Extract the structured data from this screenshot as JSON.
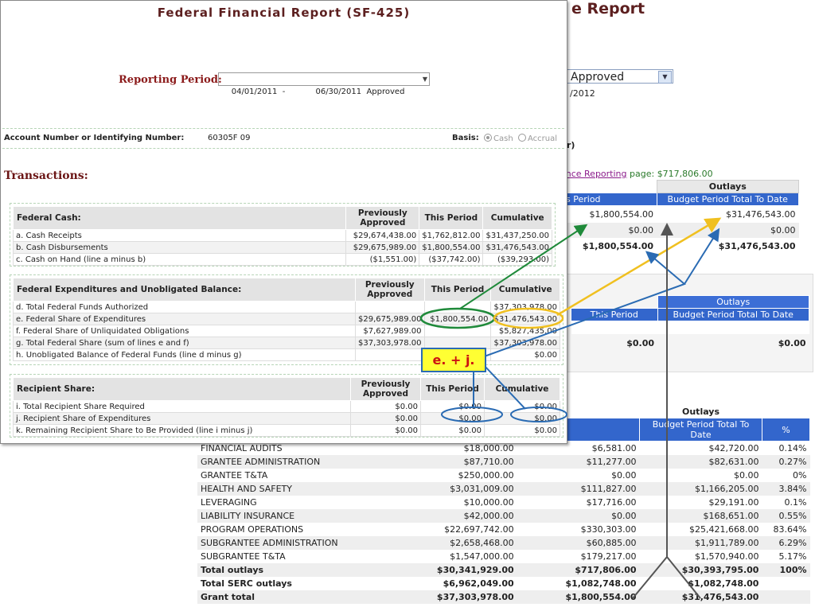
{
  "background": {
    "title": "e Report",
    "status_select": "Approved",
    "year_text": "/2012",
    "paren_text": "r)",
    "link_prefix": "ance Reporting",
    "link_suffix": " page: ",
    "link_amount": "$717,806.00",
    "panel1": {
      "outlays_label": "Outlays",
      "col_this_period": "s Period",
      "col_budget_total": "Budget Period Total To Date",
      "rows": [
        {
          "this_period": "$1,800,554.00",
          "budget_total": "$31,476,543.00",
          "bold": false
        },
        {
          "this_period": "$0.00",
          "budget_total": "$0.00",
          "bold": false
        },
        {
          "this_period": "$1,800,554.00",
          "budget_total": "$31,476,543.00",
          "bold": true
        }
      ]
    },
    "panel2": {
      "outlays_label": "Outlays",
      "col_this_period": "This Period",
      "col_budget_total": "Budget Period Total To Date",
      "total_this_period": "$0.00",
      "total_budget": "$0.00"
    },
    "panel3": {
      "outlays_label": "Outlays",
      "col_this_period": "s Period",
      "col_budget_total": "Budget Period Total To Date",
      "col_pct": "%",
      "rows": [
        {
          "name": "FINANCIAL AUDITS",
          "budget": "$18,000.00",
          "this_period": "$6,581.00",
          "total": "$42,720.00",
          "pct": "0.14%",
          "bold": false
        },
        {
          "name": "GRANTEE ADMINISTRATION",
          "budget": "$87,710.00",
          "this_period": "$11,277.00",
          "total": "$82,631.00",
          "pct": "0.27%",
          "bold": false
        },
        {
          "name": "GRANTEE T&TA",
          "budget": "$250,000.00",
          "this_period": "$0.00",
          "total": "$0.00",
          "pct": "0%",
          "bold": false
        },
        {
          "name": "HEALTH AND SAFETY",
          "budget": "$3,031,009.00",
          "this_period": "$111,827.00",
          "total": "$1,166,205.00",
          "pct": "3.84%",
          "bold": false
        },
        {
          "name": "LEVERAGING",
          "budget": "$10,000.00",
          "this_period": "$17,716.00",
          "total": "$29,191.00",
          "pct": "0.1%",
          "bold": false
        },
        {
          "name": "LIABILITY INSURANCE",
          "budget": "$42,000.00",
          "this_period": "$0.00",
          "total": "$168,651.00",
          "pct": "0.55%",
          "bold": false
        },
        {
          "name": "PROGRAM OPERATIONS",
          "budget": "$22,697,742.00",
          "this_period": "$330,303.00",
          "total": "$25,421,668.00",
          "pct": "83.64%",
          "bold": false
        },
        {
          "name": "SUBGRANTEE ADMINISTRATION",
          "budget": "$2,658,468.00",
          "this_period": "$60,885.00",
          "total": "$1,911,789.00",
          "pct": "6.29%",
          "bold": false
        },
        {
          "name": "SUBGRANTEE T&TA",
          "budget": "$1,547,000.00",
          "this_period": "$179,217.00",
          "total": "$1,570,940.00",
          "pct": "5.17%",
          "bold": false
        },
        {
          "name": "Total outlays",
          "budget": "$30,341,929.00",
          "this_period": "$717,806.00",
          "total": "$30,393,795.00",
          "pct": "100%",
          "bold": true
        },
        {
          "name": "Total SERC outlays",
          "budget": "$6,962,049.00",
          "this_period": "$1,082,748.00",
          "total": "$1,082,748.00",
          "pct": "",
          "bold": true
        },
        {
          "name": "Grant total",
          "budget": "$37,303,978.00",
          "this_period": "$1,800,554.00",
          "total": "$31,476,543.00",
          "pct": "",
          "bold": true
        }
      ]
    }
  },
  "form": {
    "title": "Federal Financial Report (SF-425)",
    "reporting_period_label": "Reporting Period:",
    "reporting_period_value": "04/01/2011  -            06/30/2011  Approved",
    "account_label": "Account Number or Identifying Number:",
    "account_value": "60305F 09",
    "basis_label": "Basis:",
    "basis_cash": "Cash",
    "basis_accrual": "Accrual",
    "transactions_label": "Transactions:",
    "col_previously": "Previously Approved",
    "col_this_period": "This Period",
    "col_cumulative": "Cumulative",
    "federal_cash": {
      "heading": "Federal Cash:",
      "rows": [
        {
          "label": "a. Cash Receipts",
          "prev": "$29,674,438.00",
          "this": "$1,762,812.00",
          "cum": "$31,437,250.00"
        },
        {
          "label": "b. Cash Disbursements",
          "prev": "$29,675,989.00",
          "this": "$1,800,554.00",
          "cum": "$31,476,543.00"
        },
        {
          "label": "c. Cash on Hand (line a minus b)",
          "prev": "($1,551.00)",
          "this": "($37,742.00)",
          "cum": "($39,293.00)"
        }
      ]
    },
    "federal_expenditures": {
      "heading": "Federal Expenditures and Unobligated Balance:",
      "rows": [
        {
          "label": "d. Total Federal Funds Authorized",
          "prev": "",
          "this": "",
          "cum": "$37,303,978.00"
        },
        {
          "label": "e. Federal Share of Expenditures",
          "prev": "$29,675,989.00",
          "this": "$1,800,554.00",
          "cum": "$31,476,543.00"
        },
        {
          "label": "f. Federal Share of Unliquidated Obligations",
          "prev": "$7,627,989.00",
          "this": "",
          "cum": "$5,827,435.00"
        },
        {
          "label": "g. Total Federal Share (sum of lines e and f)",
          "prev": "$37,303,978.00",
          "this": "",
          "cum": "$37,303,978.00"
        },
        {
          "label": "h. Unobligated Balance of Federal Funds (line d minus g)",
          "prev": "",
          "this": "",
          "cum": "$0.00"
        }
      ]
    },
    "recipient_share": {
      "heading": "Recipient Share:",
      "rows": [
        {
          "label": "i. Total Recipient Share Required",
          "prev": "$0.00",
          "this": "$0.00",
          "cum": "$0.00"
        },
        {
          "label": "j. Recipient Share of Expenditures",
          "prev": "$0.00",
          "this": "$0.00",
          "cum": "$0.00"
        },
        {
          "label": "k. Remaining Recipient Share to Be Provided (line i minus j)",
          "prev": "$0.00",
          "this": "$0.00",
          "cum": "$0.00"
        }
      ]
    }
  },
  "annotation": {
    "callout_text": "e. + j.",
    "colors": {
      "green": "#1f8a3a",
      "yellow": "#f0c020",
      "blue": "#2a6bb3",
      "gray": "#555555"
    }
  }
}
